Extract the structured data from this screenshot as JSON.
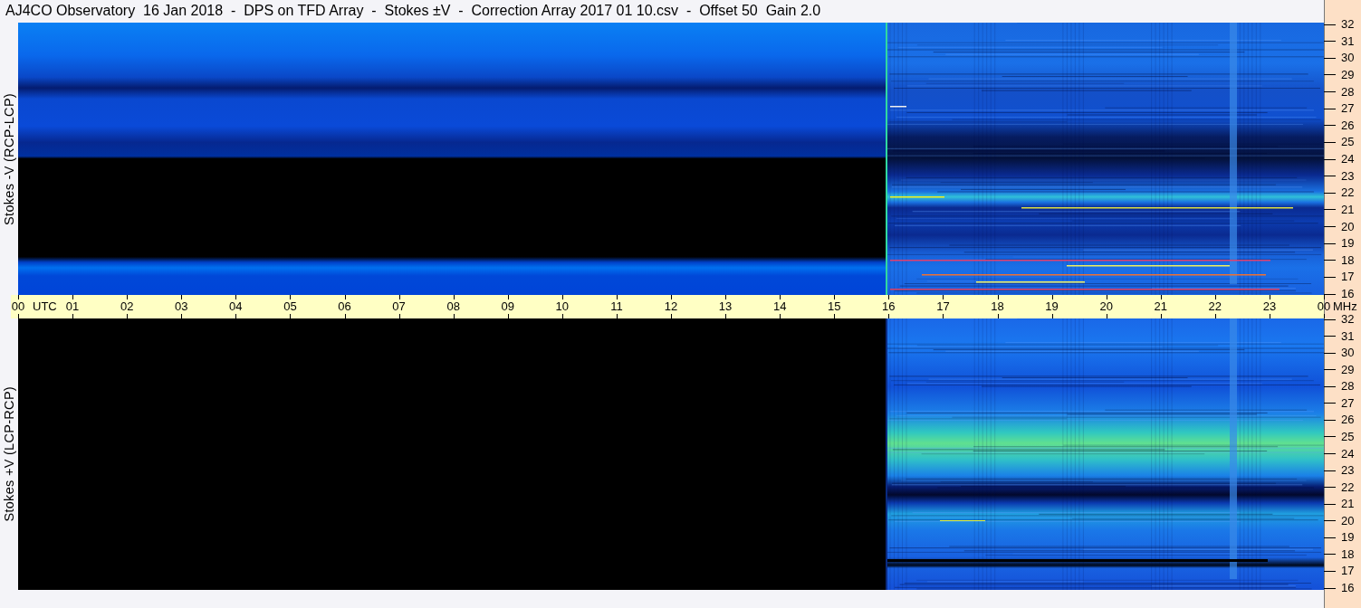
{
  "title": "AJ4CO Observatory  16 Jan 2018  -  DPS on TFD Array  -  Stokes ±V  -  Correction Array 2017 01 10.csv  -  Offset 50  Gain 2.0",
  "panels": [
    {
      "label": "Stokes -V (RCP-LCP)",
      "freq_ticks": [
        "32",
        "31",
        "30",
        "29",
        "28",
        "27",
        "26",
        "25",
        "24",
        "23",
        "22",
        "21",
        "20",
        "19",
        "18",
        "17",
        "16"
      ]
    },
    {
      "label": "Stokes +V (LCP-RCP)",
      "freq_ticks": [
        "32",
        "31",
        "30",
        "29",
        "28",
        "27",
        "26",
        "25",
        "24",
        "23",
        "22",
        "21",
        "20",
        "19",
        "18",
        "17",
        "16"
      ]
    }
  ],
  "time_axis": {
    "ticks": [
      "00",
      "01",
      "02",
      "03",
      "04",
      "05",
      "06",
      "07",
      "08",
      "09",
      "10",
      "11",
      "12",
      "13",
      "14",
      "15",
      "16",
      "17",
      "18",
      "19",
      "20",
      "21",
      "22",
      "23",
      "00"
    ],
    "unit": "UTC",
    "freq_unit": "MHz"
  }
}
